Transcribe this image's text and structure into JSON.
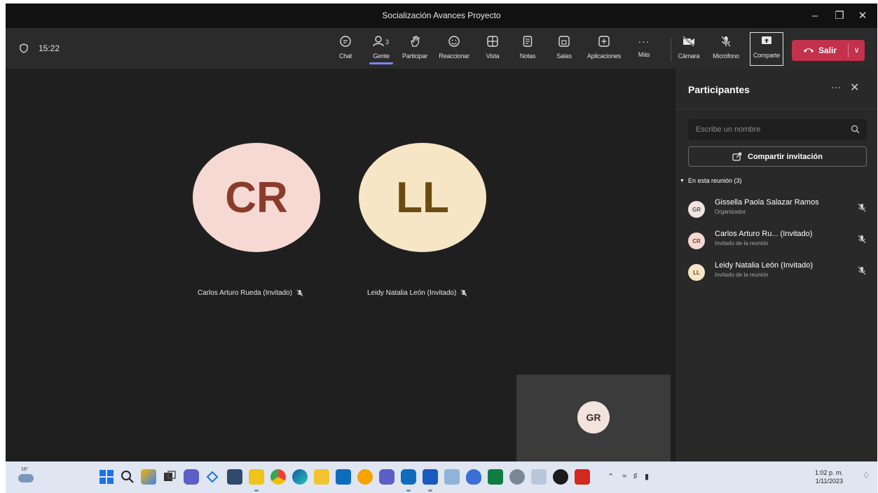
{
  "window": {
    "title": "Socialización Avances Proyecto"
  },
  "toolbar": {
    "timer": "15:22",
    "buttons": [
      {
        "label": "Chat",
        "icon": "chat-icon"
      },
      {
        "label": "Gente",
        "icon": "people-icon",
        "badge": "3"
      },
      {
        "label": "Participar",
        "icon": "raise-hand-icon"
      },
      {
        "label": "Reaccionar",
        "icon": "smile-icon"
      },
      {
        "label": "Vista",
        "icon": "grid-view-icon"
      },
      {
        "label": "Notas",
        "icon": "notes-icon"
      },
      {
        "label": "Salas",
        "icon": "rooms-icon"
      },
      {
        "label": "Aplicaciones",
        "icon": "apps-icon"
      },
      {
        "label": "Más",
        "icon": "more-icon"
      }
    ],
    "media": [
      {
        "label": "Cámara",
        "icon": "camera-off-icon"
      },
      {
        "label": "Micrófono",
        "icon": "mic-off-icon"
      },
      {
        "label": "Comparte",
        "icon": "share-screen-icon"
      }
    ],
    "leave_label": "Salir"
  },
  "stage": {
    "tiles": [
      {
        "initials": "CR",
        "name": "Carlos Arturo Rueda (Invitado)"
      },
      {
        "initials": "LL",
        "name": "Leidy Natalia León (Invitado)"
      }
    ],
    "self_initials": "GR"
  },
  "panel": {
    "title": "Participantes",
    "search_placeholder": "Escribe un nombre",
    "invite_label": "Compartir invitación",
    "section_label": "En esta reunión (3)",
    "participants": [
      {
        "initials": "GR",
        "name": "Gissella Paola Salazar Ramos",
        "role": "Organizador"
      },
      {
        "initials": "CR",
        "name": "Carlos Arturo Ru... (Invitado)",
        "role": "Invitado de la reunión"
      },
      {
        "initials": "LL",
        "name": "Leidy Natalia León (Invitado)",
        "role": "Invitado de la reunión"
      }
    ]
  },
  "taskbar": {
    "weather_temp": "16°",
    "clock_time": "1:02 p. m.",
    "clock_date": "1/11/2023"
  },
  "colors": {
    "accent": "#7f85f5",
    "leave": "#c4314b",
    "cr_bg": "#f5d9d2",
    "cr_fg": "#8a3b2b",
    "ll_bg": "#f6e6c5",
    "ll_fg": "#6b4b12"
  }
}
